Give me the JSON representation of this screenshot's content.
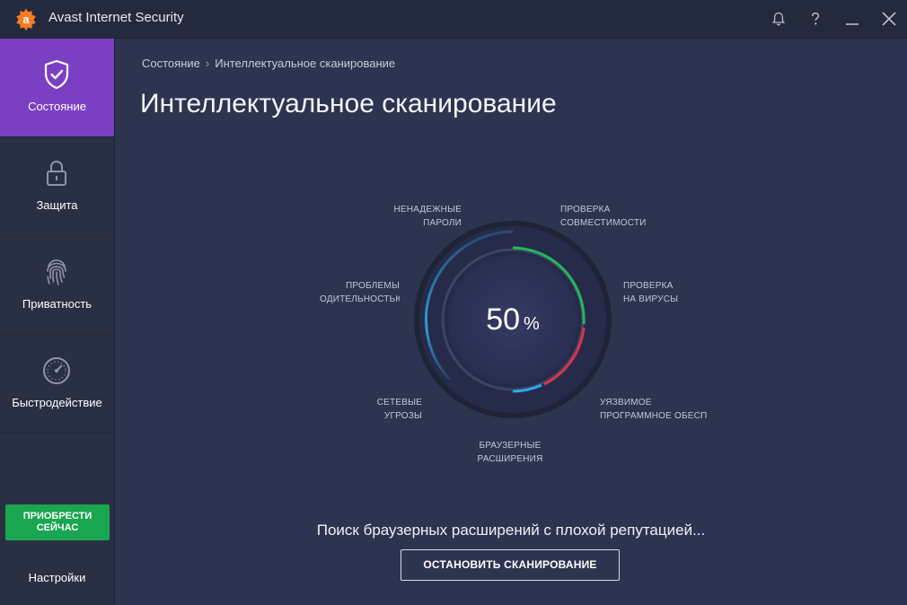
{
  "titlebar": {
    "app_title": "Avast Internet Security",
    "icons": [
      "bell-icon",
      "help-icon",
      "minimize-icon",
      "close-icon"
    ]
  },
  "sidebar": {
    "items": [
      {
        "label": "Состояние",
        "icon": "shield-check-icon",
        "active": true
      },
      {
        "label": "Защита",
        "icon": "lock-icon",
        "active": false
      },
      {
        "label": "Приватность",
        "icon": "fingerprint-icon",
        "active": false
      },
      {
        "label": "Быстродействие",
        "icon": "speedometer-icon",
        "active": false
      }
    ],
    "buy_button": "ПРИОБРЕСТИ СЕЙЧАС",
    "settings": "Настройки"
  },
  "breadcrumb": {
    "root": "Состояние",
    "separator": "›",
    "current": "Интеллектуальное сканирование"
  },
  "page_title": "Интеллектуальное сканирование",
  "scan": {
    "progress_value": "50",
    "progress_unit": "%",
    "progress_fraction": 0.5,
    "steps": [
      {
        "line1": "ПРОВЕРКА",
        "line2": "СОВМЕСТИМОСТИ"
      },
      {
        "line1": "ПРОВЕРКА",
        "line2": "НА ВИРУСЫ"
      },
      {
        "line1": "УЯЗВИМОЕ",
        "line2": "ПРОГРАММНОЕ ОБЕСП"
      },
      {
        "line1": "БРАУЗЕРНЫЕ",
        "line2": "РАСШИРЕНИЯ"
      },
      {
        "line1": "СЕТЕВЫЕ",
        "line2": "УГРОЗЫ"
      },
      {
        "line1": "ПРОБЛЕМЫ",
        "line2": "ОДИТЕЛЬНОСТЬЮ"
      },
      {
        "line1": "НЕНАДЕЖНЫЕ",
        "line2": "ПАРОЛИ"
      }
    ],
    "status": "Поиск браузерных расширений с плохой репутацией...",
    "stop_button": "ОСТАНОВИТЬ СКАНИРОВАНИЕ"
  },
  "colors": {
    "accent_purple": "#7b3fc4",
    "buy_green": "#1aa650",
    "ring_green": "#22b85a",
    "ring_red": "#e0334a",
    "ring_blue": "#2fa8e6",
    "logo_orange": "#f57c22"
  }
}
